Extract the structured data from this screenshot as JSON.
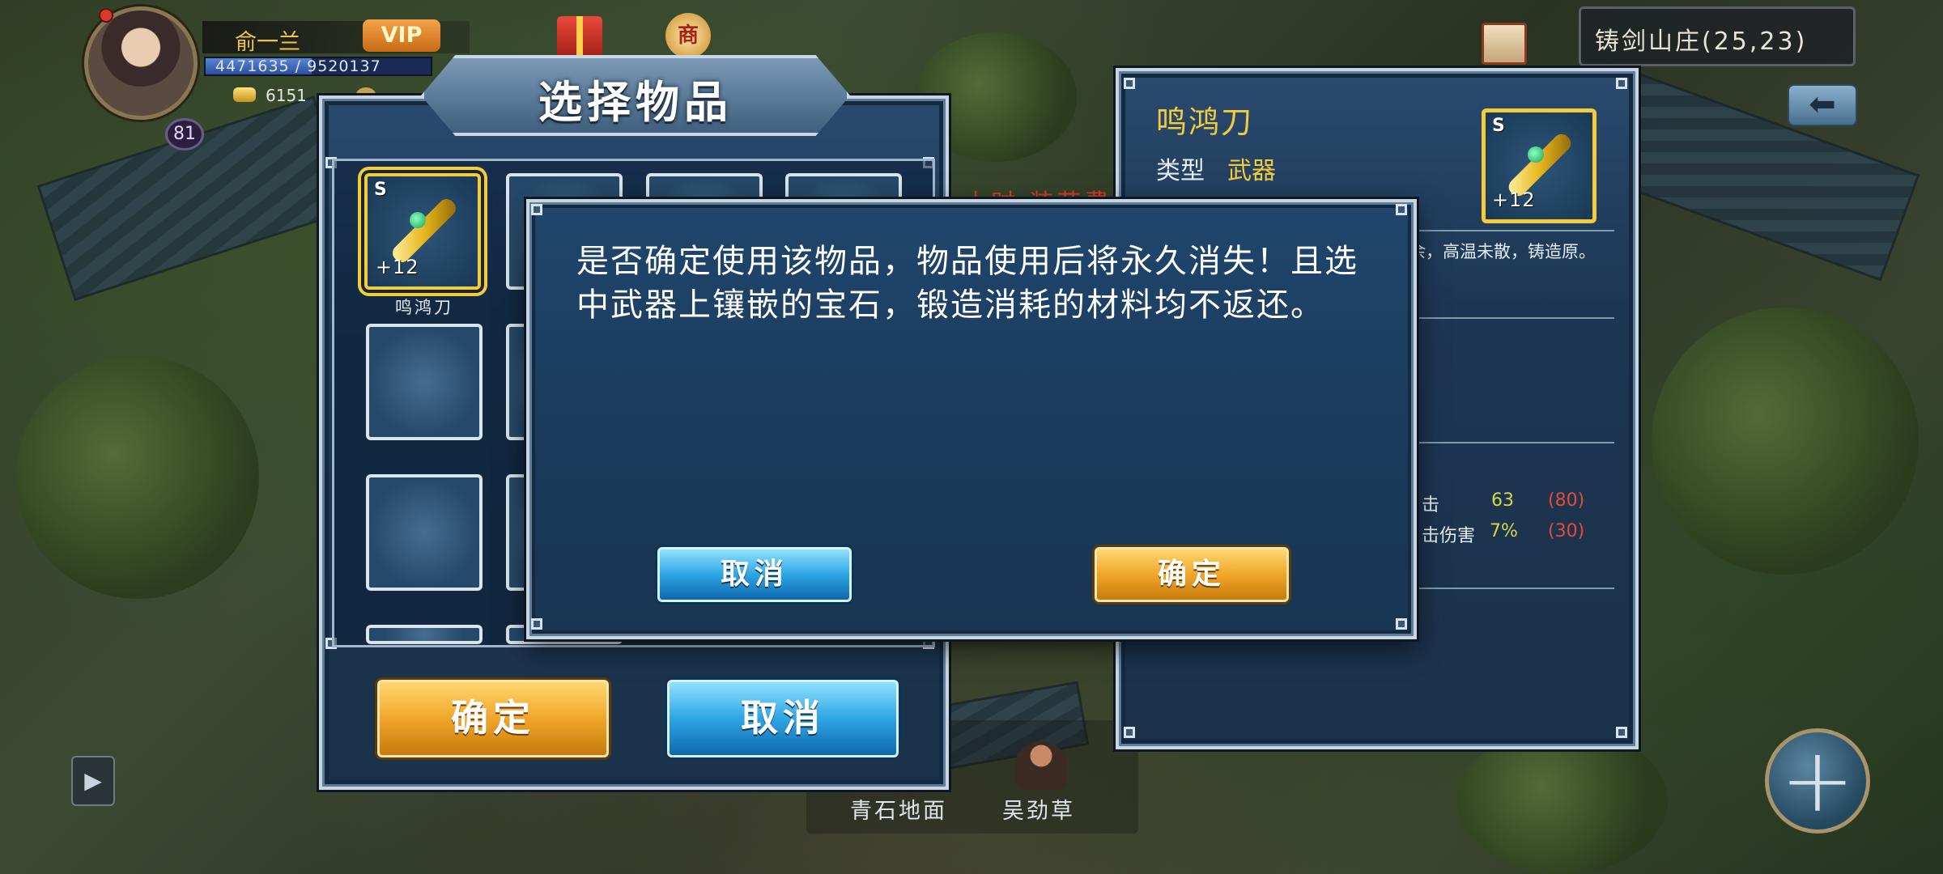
{
  "hud": {
    "player_name": "俞一兰",
    "vip_label": "VIP",
    "hp_text": "4471635 / 9520137",
    "hp_fraction": 0.47,
    "gold": "6151",
    "level": "81",
    "shop_glyph": "商"
  },
  "location": {
    "text": "铸剑山庄(25,23)"
  },
  "back_glyph": "⬅",
  "side_arrow_glyph": "▶",
  "plus_glyph": "+",
  "ground": {
    "tile_label": "青石地面",
    "npc_label": "吴劲草"
  },
  "select_panel": {
    "title": "选择物品",
    "selected_item": {
      "name": "鸣鸿刀",
      "grade": "S",
      "level": "+12"
    },
    "confirm_label": "确定",
    "cancel_label": "取消"
  },
  "peek_text": "小时 装花费",
  "detail_panel": {
    "name": "鸣鸿刀",
    "type_label": "类型",
    "type_value": "武器",
    "grade": "S",
    "level": "+12",
    "desc_fragment": "余，高温未散，铸造原。",
    "stats": [
      {
        "label": "击",
        "value": "63",
        "max": "(80)"
      },
      {
        "label": "击伤害",
        "value": "7%",
        "max": "(30)"
      }
    ]
  },
  "dialog": {
    "message": "是否确定使用该物品，物品使用后将永久消失！且选中武器上镶嵌的宝石，锻造消耗的材料均不返还。",
    "cancel_label": "取消",
    "confirm_label": "确定"
  },
  "colors": {
    "accent_gold": "#f2cc3c",
    "panel_blue": "#1d3653",
    "stat_green": "#d6d84a",
    "stat_red": "#e44b3b"
  }
}
